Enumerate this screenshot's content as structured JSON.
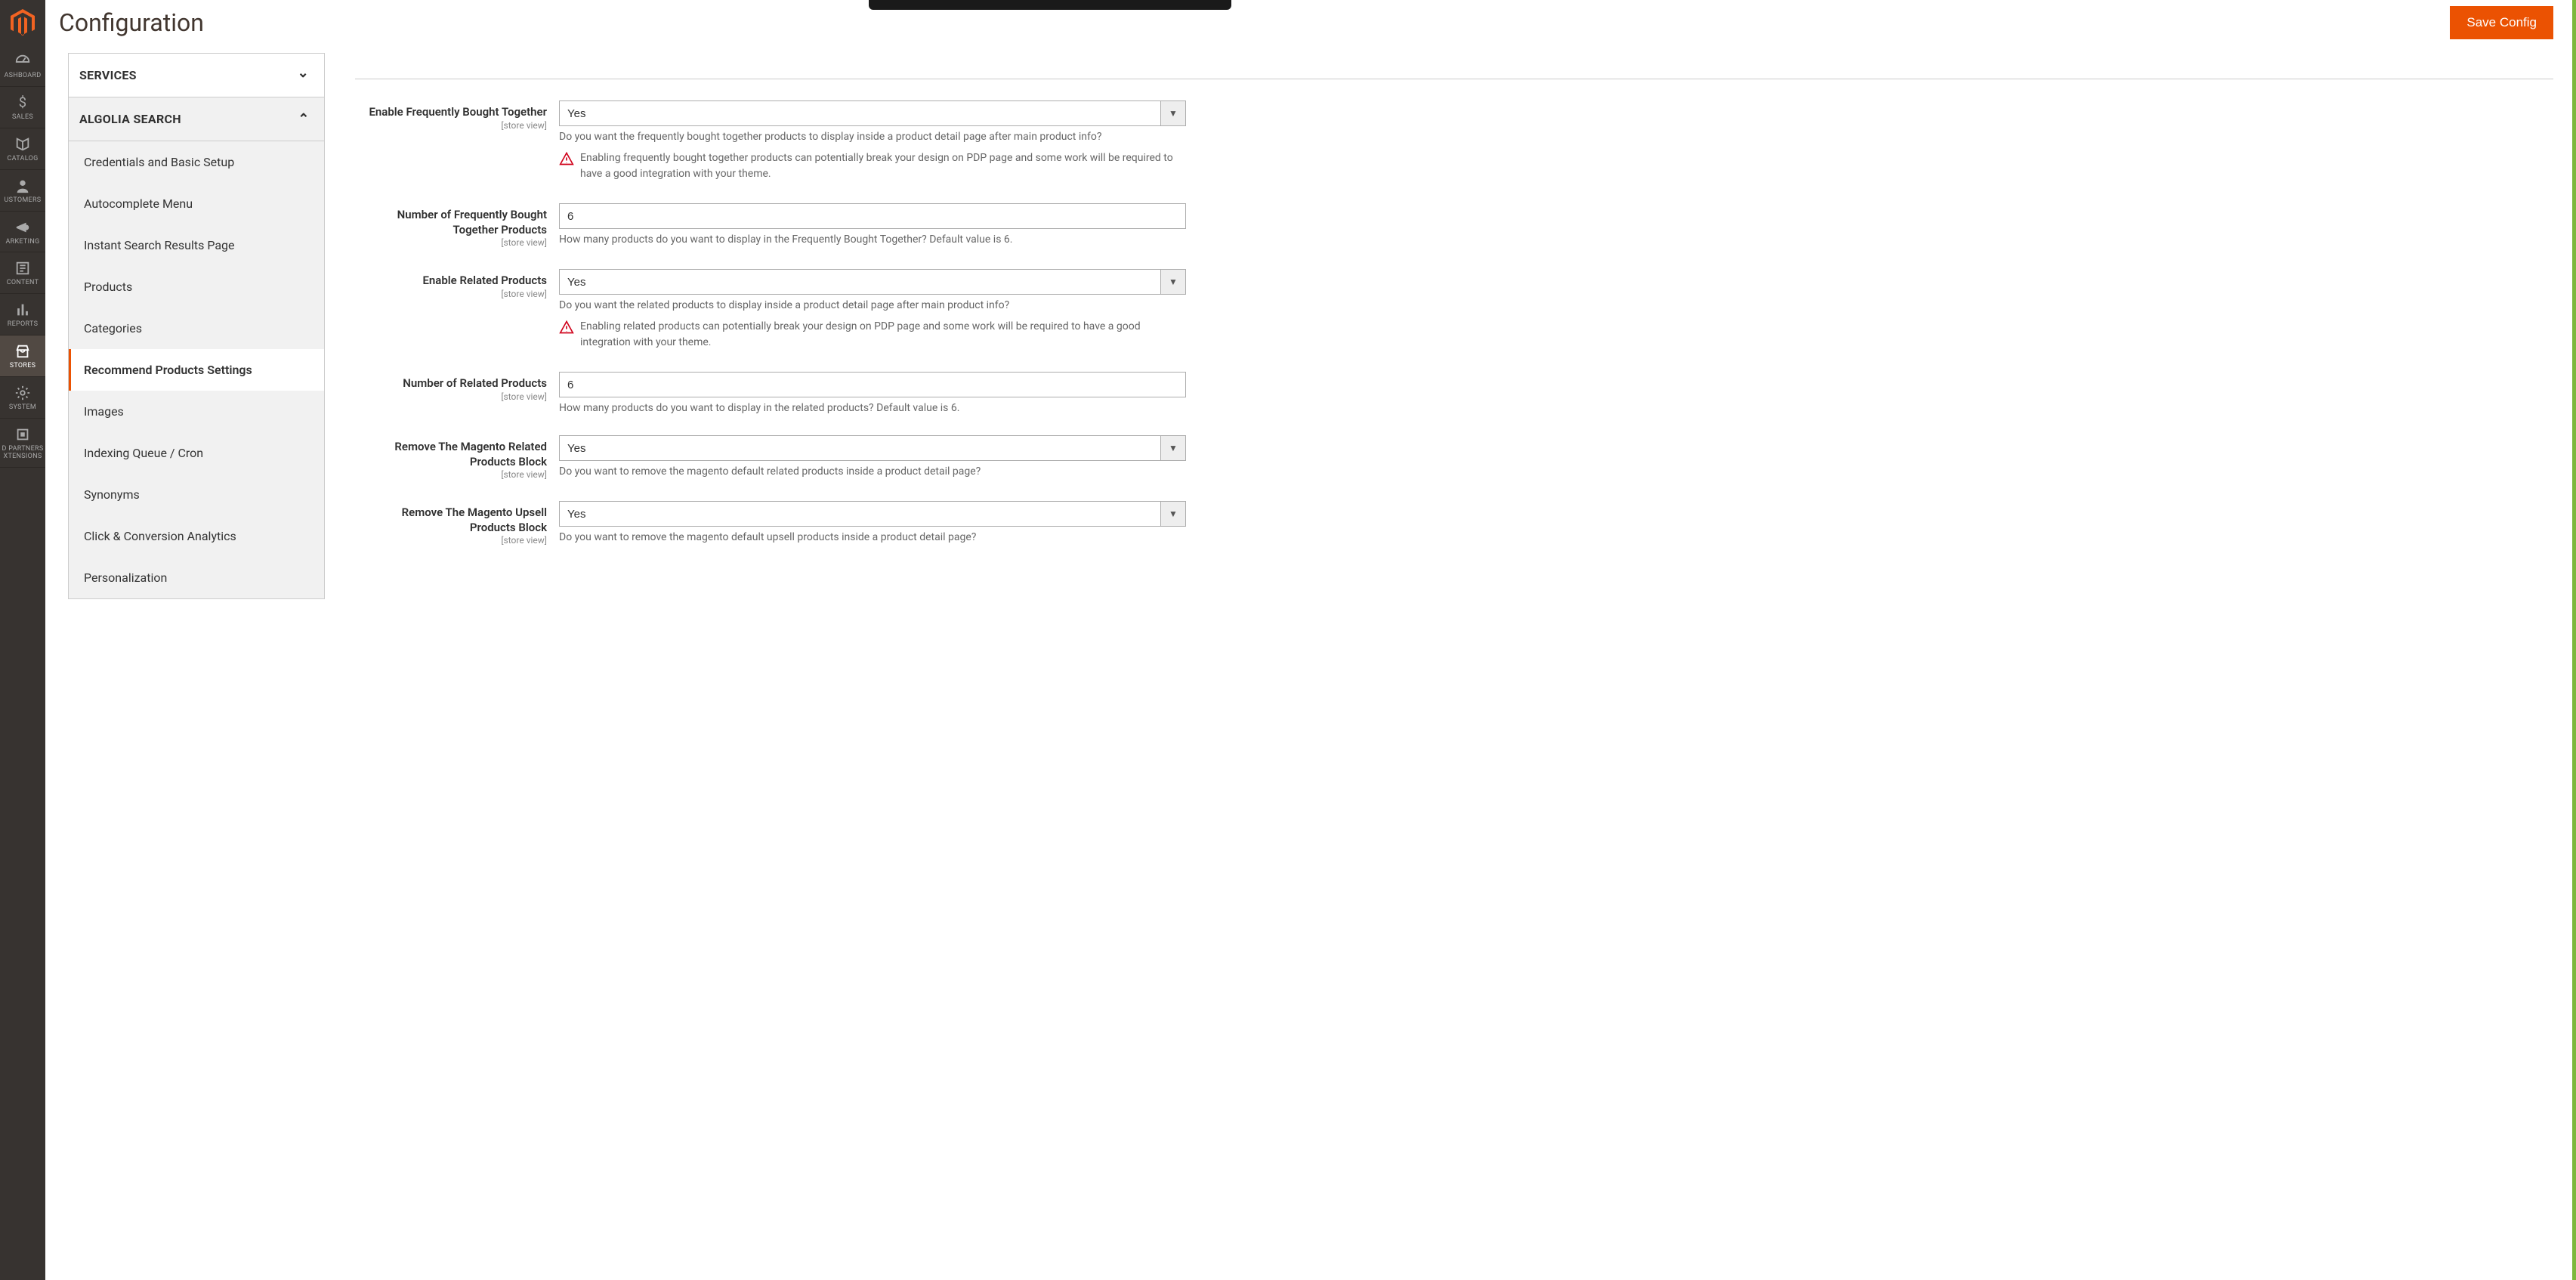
{
  "page_title": "Configuration",
  "save_button": "Save Config",
  "admin_nav": [
    {
      "id": "dashboard",
      "label": "ASHBOARD"
    },
    {
      "id": "sales",
      "label": "SALES"
    },
    {
      "id": "catalog",
      "label": "CATALOG"
    },
    {
      "id": "customers",
      "label": "USTOMERS"
    },
    {
      "id": "marketing",
      "label": "ARKETING"
    },
    {
      "id": "content",
      "label": "CONTENT"
    },
    {
      "id": "reports",
      "label": "REPORTS"
    },
    {
      "id": "stores",
      "label": "STORES",
      "active": true
    },
    {
      "id": "system",
      "label": "SYSTEM"
    },
    {
      "id": "partners",
      "label": "D PARTNERS XTENSIONS"
    }
  ],
  "config_sections": {
    "services": {
      "label": "SERVICES",
      "expanded": false
    },
    "algolia": {
      "label": "ALGOLIA SEARCH",
      "expanded": true,
      "items": [
        "Credentials and Basic Setup",
        "Autocomplete Menu",
        "Instant Search Results Page",
        "Products",
        "Categories",
        "Recommend Products Settings",
        "Images",
        "Indexing Queue / Cron",
        "Synonyms",
        "Click & Conversion Analytics",
        "Personalization"
      ],
      "active_index": 5
    }
  },
  "scope_label": "[store view]",
  "fields": {
    "enable_fbt": {
      "label": "Enable Frequently Bought Together",
      "value": "Yes",
      "help": "Do you want the frequently bought together products to display inside a product detail page after main product info?",
      "warning": "Enabling frequently bought together products can potentially break your design on PDP page and some work will be required to have a good integration with your theme."
    },
    "num_fbt": {
      "label": "Number of Frequently Bought Together Products",
      "value": "6",
      "help": "How many products do you want to display in the Frequently Bought Together? Default value is 6."
    },
    "enable_related": {
      "label": "Enable Related Products",
      "value": "Yes",
      "help": "Do you want the related products to display inside a product detail page after main product info?",
      "warning": "Enabling related products can potentially break your design on PDP page and some work will be required to have a good integration with your theme."
    },
    "num_related": {
      "label": "Number of Related Products",
      "value": "6",
      "help": "How many products do you want to display in the related products? Default value is 6."
    },
    "remove_related": {
      "label": "Remove The Magento Related Products Block",
      "value": "Yes",
      "help": "Do you want to remove the magento default related products inside a product detail page?"
    },
    "remove_upsell": {
      "label": "Remove The Magento Upsell Products Block",
      "value": "Yes",
      "help": "Do you want to remove the magento default upsell products inside a product detail page?"
    }
  }
}
